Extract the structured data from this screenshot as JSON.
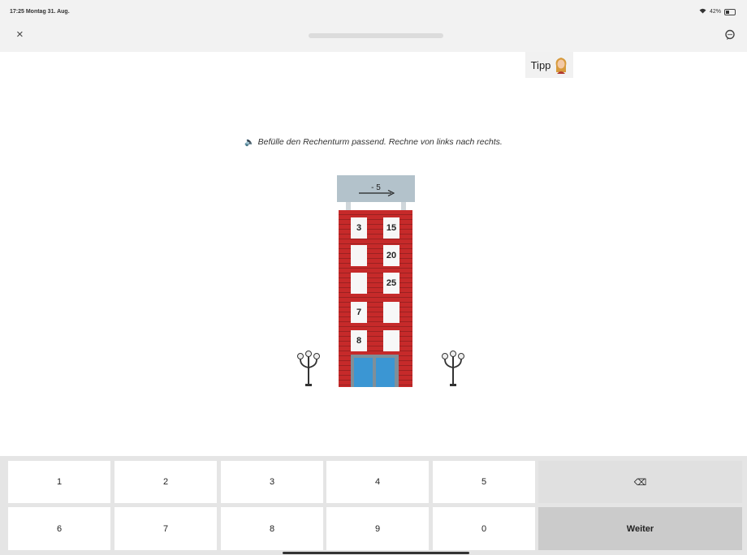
{
  "status_bar": {
    "time_date": "17:25  Montag 31. Aug.",
    "battery": "42%"
  },
  "header": {
    "close_icon": "×",
    "chat_icon": "chat-bubble",
    "progress": 0
  },
  "hint": {
    "label": "Tipp"
  },
  "instruction": {
    "speaker_icon": "🔈",
    "text": "Befülle den Rechenturm passend. Rechne von links nach rechts."
  },
  "tower": {
    "operation": "- 5",
    "floors": [
      {
        "left": "3",
        "right": "15"
      },
      {
        "left": "",
        "right": "20"
      },
      {
        "left": "",
        "right": "25"
      },
      {
        "left": "7",
        "right": ""
      },
      {
        "left": "8",
        "right": ""
      }
    ]
  },
  "keypad": {
    "row1": [
      "1",
      "2",
      "3",
      "4",
      "5"
    ],
    "row2": [
      "6",
      "7",
      "8",
      "9",
      "0"
    ],
    "backspace_icon": "⌫",
    "submit_label": "Weiter"
  },
  "colors": {
    "brick": "#c62a2a",
    "door": "#3b96d3",
    "roof": "#b3c2cb"
  }
}
